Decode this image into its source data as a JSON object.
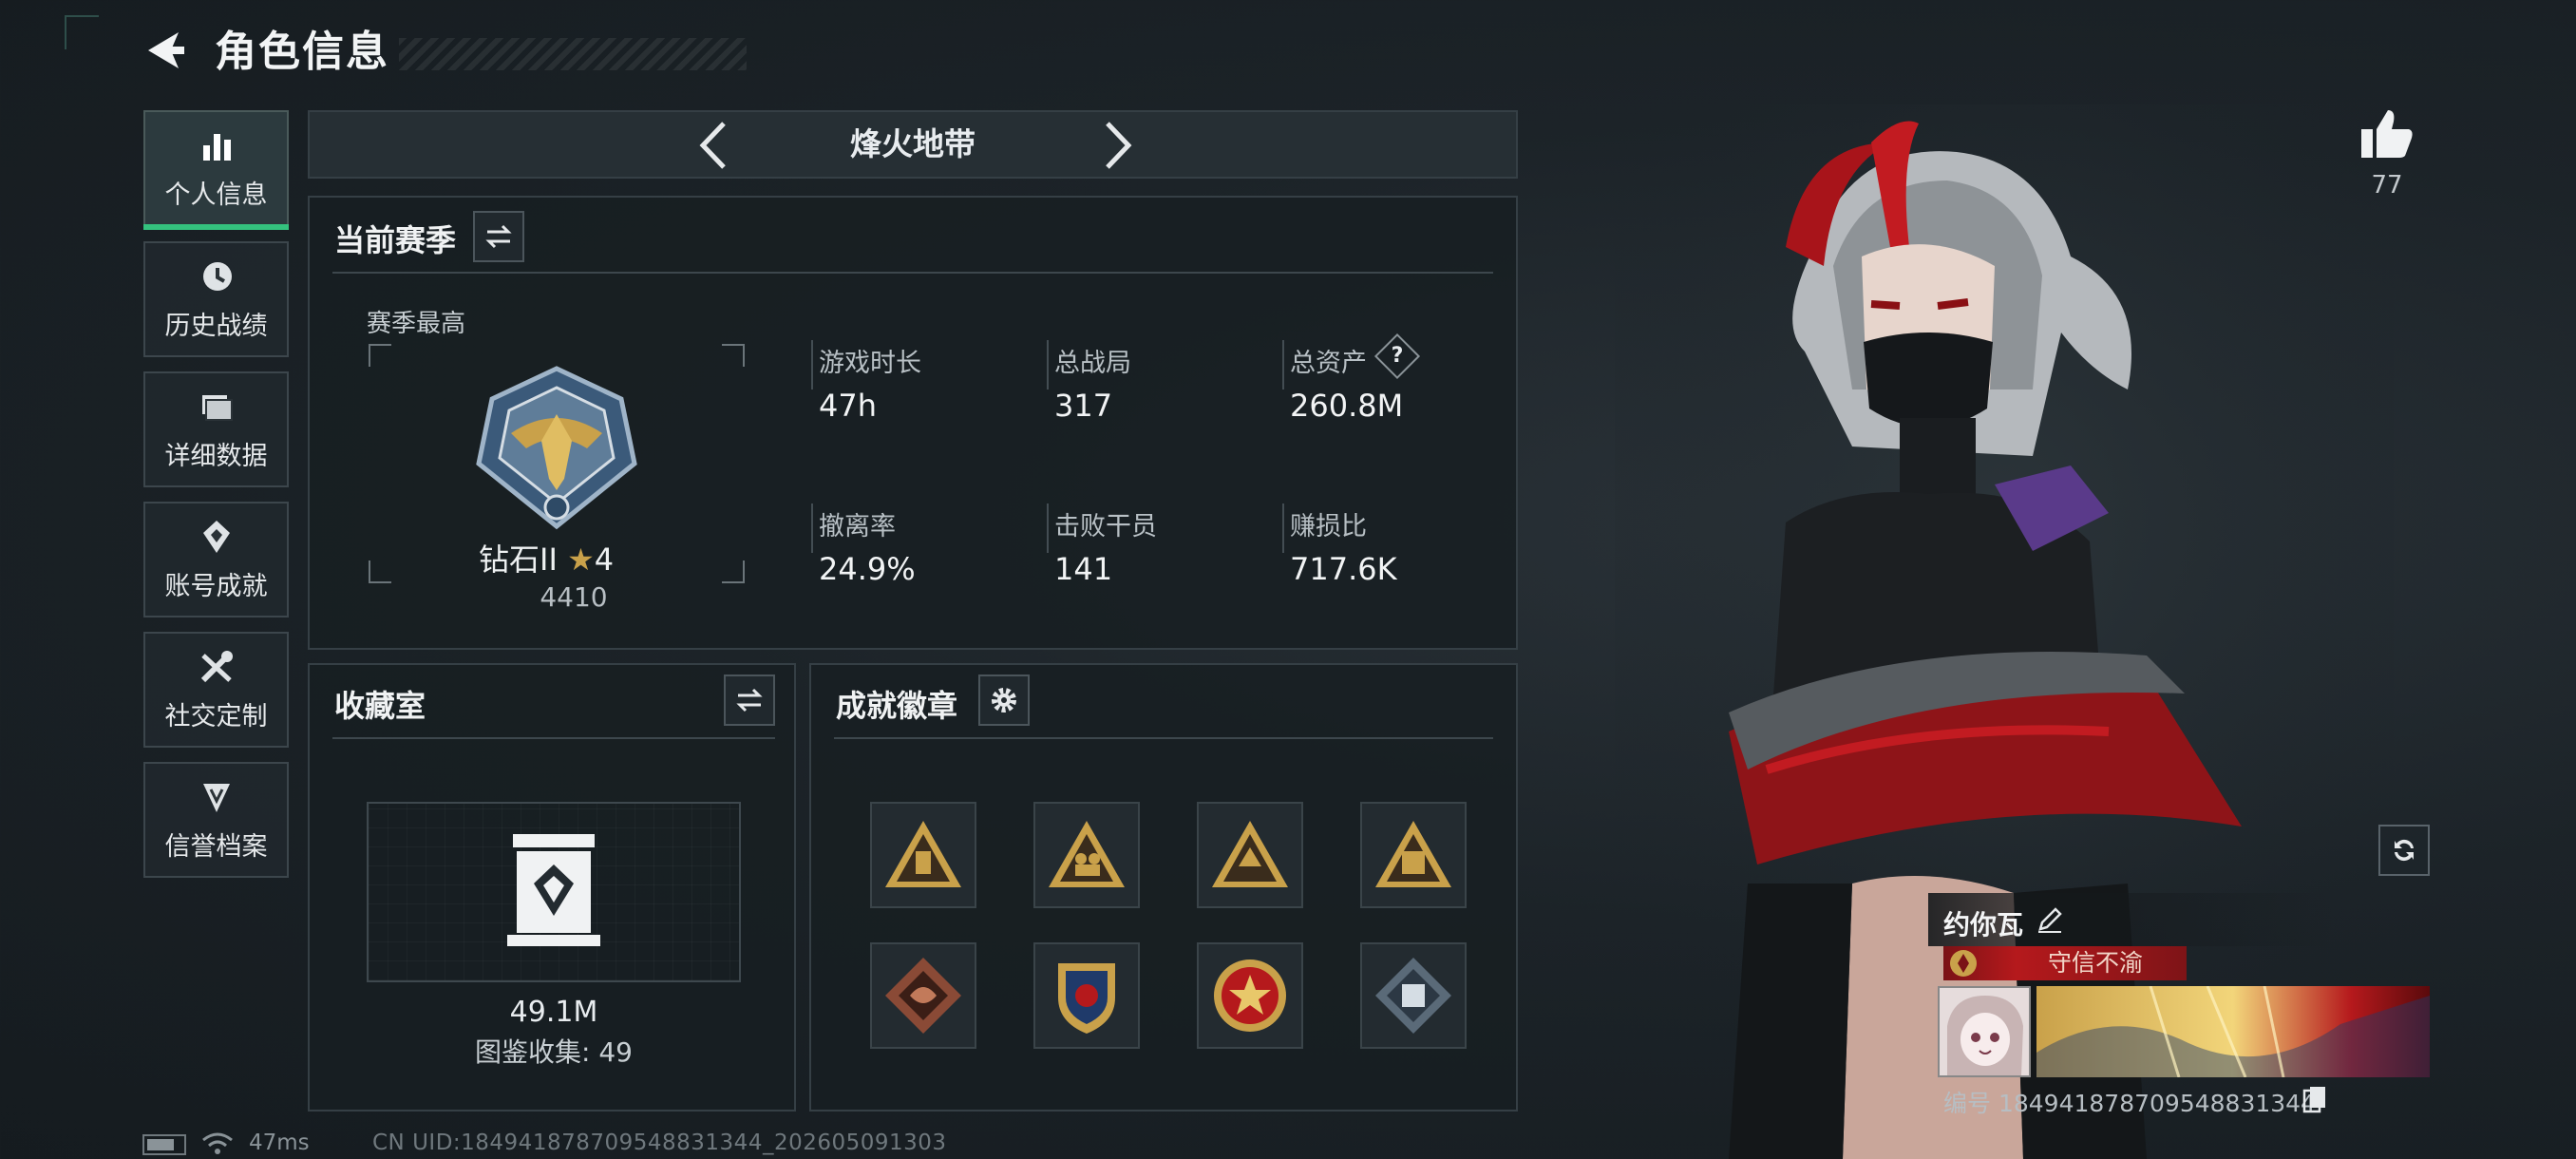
{
  "header": {
    "title": "角色信息"
  },
  "sidebar": {
    "items": [
      {
        "label": "个人信息",
        "icon": "bar-chart-icon",
        "active": true
      },
      {
        "label": "历史战绩",
        "icon": "history-icon",
        "active": false
      },
      {
        "label": "详细数据",
        "icon": "folder-icon",
        "active": false
      },
      {
        "label": "账号成就",
        "icon": "achievement-icon",
        "active": false
      },
      {
        "label": "社交定制",
        "icon": "tools-icon",
        "active": false
      },
      {
        "label": "信誉档案",
        "icon": "credit-icon",
        "active": false
      }
    ]
  },
  "map_selector": {
    "current": "烽火地带"
  },
  "season": {
    "title": "当前赛季",
    "best_label": "赛季最高",
    "rank": {
      "name": "钻石II",
      "stars": "4",
      "score": "4410"
    },
    "stats": [
      {
        "label": "游戏时长",
        "value": "47h"
      },
      {
        "label": "总战局",
        "value": "317"
      },
      {
        "label": "总资产",
        "value": "260.8M",
        "help": "?"
      },
      {
        "label": "撤离率",
        "value": "24.9%"
      },
      {
        "label": "击败干员",
        "value": "141"
      },
      {
        "label": "赚损比",
        "value": "717.6K"
      }
    ]
  },
  "collection": {
    "title": "收藏室",
    "value": "49.1M",
    "catalog_label": "图鉴收集: 49"
  },
  "achievements": {
    "title": "成就徽章",
    "badge_count": 8
  },
  "character": {
    "likes": "77",
    "nickname": "约你瓦",
    "title_badge": "守信不渝",
    "player_id": "编号 1849418787095488313​44"
  },
  "footer": {
    "ping": "47ms",
    "uid": "CN UID:1849418787095488313​44_202605091303"
  },
  "colors": {
    "accent_green": "#34c27e",
    "badge_red": "#b5191c",
    "gold": "#c9a14a"
  }
}
